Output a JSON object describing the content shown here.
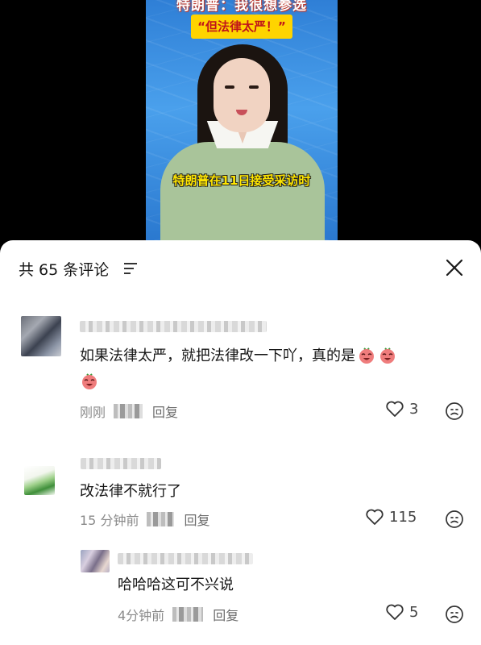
{
  "video": {
    "headline": "特朗普：我很想参选",
    "quote": "“但法律太严！”",
    "caption": "特朗普在11日接受采访时"
  },
  "sheet": {
    "title": "共 65 条评论",
    "filter_icon": "sort-filter-icon",
    "close_icon": "close-icon"
  },
  "comments": [
    {
      "text": "如果法律太严，就把法律改一下吖，真的是",
      "emoji": "laughing-radish-emoji",
      "time": "刚刚",
      "reply_label": "回复",
      "likes": "3"
    },
    {
      "text": "改法律不就行了",
      "time": "15 分钟前",
      "reply_label": "回复",
      "likes": "115"
    },
    {
      "text": "哈哈哈这可不兴说",
      "time": "4分钟前",
      "reply_label": "回复",
      "likes": "5"
    }
  ],
  "icons": {
    "like": "heart-outline-icon",
    "dislike": "frown-face-icon"
  },
  "colors": {
    "quote_badge": "#ffd400",
    "caption_text": "#ffe600",
    "meta_text": "#8a8a8a"
  }
}
